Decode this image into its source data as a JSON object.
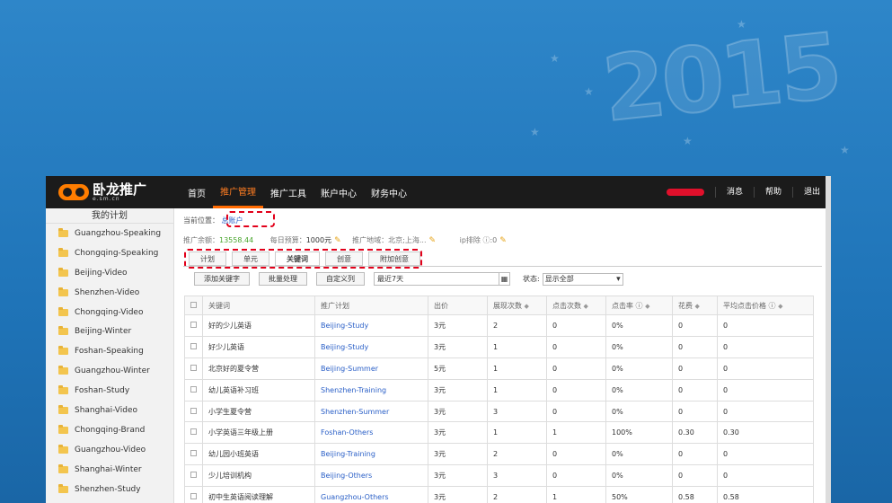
{
  "background": {
    "year_text": "2015"
  },
  "app": {
    "logo": {
      "name": "卧龙推广",
      "sub": "e.sm.cn"
    },
    "nav": [
      "首页",
      "推广管理",
      "推广工具",
      "账户中心",
      "财务中心"
    ],
    "nav_active_index": 1,
    "top_right": [
      "消息",
      "帮助",
      "退出"
    ]
  },
  "sidebar": {
    "header": "我的计划",
    "items": [
      "Guangzhou-Speaking",
      "Chongqing-Speaking",
      "Beijing-Video",
      "Shenzhen-Video",
      "Chongqing-Video",
      "Beijing-Winter",
      "Foshan-Speaking",
      "Guangzhou-Winter",
      "Foshan-Study",
      "Shanghai-Video",
      "Chongqing-Brand",
      "Guangzhou-Video",
      "Shanghai-Winter",
      "Shenzhen-Study"
    ]
  },
  "main": {
    "breadcrumb_label": "当前位置：",
    "breadcrumb_link": "总账户",
    "stats": {
      "balance_label": "推广余额：",
      "balance": "13558.44",
      "budget_label": "每日预算：",
      "budget": "1000元",
      "region_label": "推广地域：",
      "region": "北京;上海...",
      "ip_label": "ip排除",
      "ip_value": ":0"
    },
    "tabs": [
      "计划",
      "单元",
      "关键词",
      "创意",
      "附加创意"
    ],
    "active_tab_index": 2,
    "toolbar": {
      "add": "添加关键字",
      "batch": "批量处理",
      "custom": "自定义列",
      "date": "最近7天",
      "status_label": "状态:",
      "status_value": "显示全部"
    },
    "table": {
      "headers": [
        "关键词",
        "推广计划",
        "出价",
        "展现次数",
        "点击次数",
        "点击率",
        "花费",
        "平均点击价格"
      ],
      "rows": [
        [
          "好的少儿英语",
          "Beijing-Study",
          "3元",
          "2",
          "0",
          "0%",
          "0",
          "0"
        ],
        [
          "好少儿英语",
          "Beijing-Study",
          "3元",
          "1",
          "0",
          "0%",
          "0",
          "0"
        ],
        [
          "北京好的夏令营",
          "Beijing-Summer",
          "5元",
          "1",
          "0",
          "0%",
          "0",
          "0"
        ],
        [
          "幼儿英语补习班",
          "Shenzhen-Training",
          "3元",
          "1",
          "0",
          "0%",
          "0",
          "0"
        ],
        [
          "小学生夏令营",
          "Shenzhen-Summer",
          "3元",
          "3",
          "0",
          "0%",
          "0",
          "0"
        ],
        [
          "小学英语三年级上册",
          "Foshan-Others",
          "3元",
          "1",
          "1",
          "100%",
          "0.30",
          "0.30"
        ],
        [
          "幼儿园小班英语",
          "Beijing-Training",
          "3元",
          "2",
          "0",
          "0%",
          "0",
          "0"
        ],
        [
          "少儿培训机构",
          "Beijing-Others",
          "3元",
          "3",
          "0",
          "0%",
          "0",
          "0"
        ],
        [
          "初中生英语阅读理解",
          "Guangzhou-Others",
          "3元",
          "2",
          "1",
          "50%",
          "0.58",
          "0.58"
        ]
      ]
    }
  }
}
